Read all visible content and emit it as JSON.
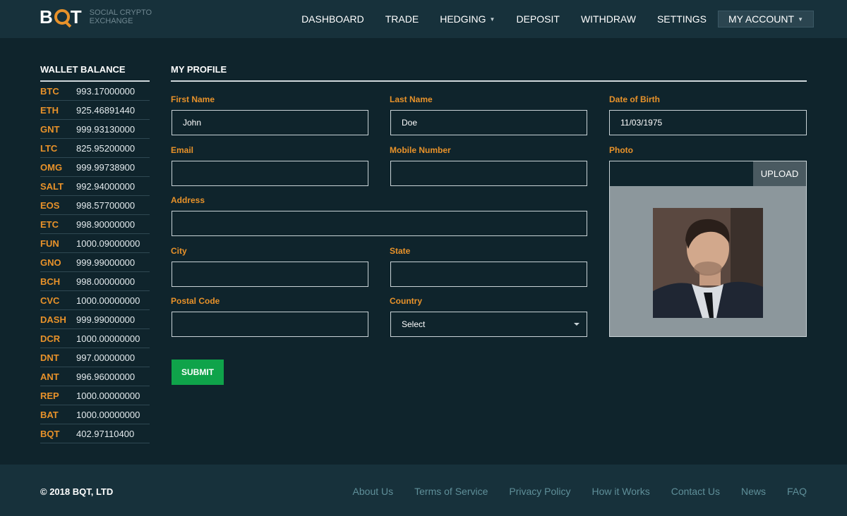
{
  "header": {
    "logo_text_left": "B",
    "logo_text_right": "T",
    "tagline_1": "SOCIAL CRYPTO",
    "tagline_2": "EXCHANGE",
    "nav": [
      {
        "label": "DASHBOARD"
      },
      {
        "label": "TRADE"
      },
      {
        "label": "HEDGING"
      },
      {
        "label": "DEPOSIT"
      },
      {
        "label": "WITHDRAW"
      },
      {
        "label": "SETTINGS"
      },
      {
        "label": "MY ACCOUNT"
      }
    ]
  },
  "sidebar": {
    "title": "WALLET BALANCE",
    "balances": [
      {
        "coin": "BTC",
        "amount": "993.17000000"
      },
      {
        "coin": "ETH",
        "amount": "925.46891440"
      },
      {
        "coin": "GNT",
        "amount": "999.93130000"
      },
      {
        "coin": "LTC",
        "amount": "825.95200000"
      },
      {
        "coin": "OMG",
        "amount": "999.99738900"
      },
      {
        "coin": "SALT",
        "amount": "992.94000000"
      },
      {
        "coin": "EOS",
        "amount": "998.57700000"
      },
      {
        "coin": "ETC",
        "amount": "998.90000000"
      },
      {
        "coin": "FUN",
        "amount": "1000.09000000"
      },
      {
        "coin": "GNO",
        "amount": "999.99000000"
      },
      {
        "coin": "BCH",
        "amount": "998.00000000"
      },
      {
        "coin": "CVC",
        "amount": "1000.00000000"
      },
      {
        "coin": "DASH",
        "amount": "999.99000000"
      },
      {
        "coin": "DCR",
        "amount": "1000.00000000"
      },
      {
        "coin": "DNT",
        "amount": "997.00000000"
      },
      {
        "coin": "ANT",
        "amount": "996.96000000"
      },
      {
        "coin": "REP",
        "amount": "1000.00000000"
      },
      {
        "coin": "BAT",
        "amount": "1000.00000000"
      },
      {
        "coin": "BQT",
        "amount": "402.97110400"
      }
    ]
  },
  "profile": {
    "title": "MY PROFILE",
    "first_name_label": "First Name",
    "first_name_value": "John",
    "last_name_label": "Last Name",
    "last_name_value": "Doe",
    "dob_label": "Date of Birth",
    "dob_value": "11/03/1975",
    "email_label": "Email",
    "email_value": "",
    "mobile_label": "Mobile Number",
    "mobile_value": "",
    "photo_label": "Photo",
    "upload_label": "UPLOAD",
    "address_label": "Address",
    "address_value": "",
    "city_label": "City",
    "city_value": "",
    "state_label": "State",
    "state_value": "",
    "postal_label": "Postal Code",
    "postal_value": "",
    "country_label": "Country",
    "country_selected": "Select",
    "submit_label": "SUBMIT"
  },
  "footer": {
    "copyright": "© 2018 BQT, LTD",
    "links": [
      {
        "label": "About Us"
      },
      {
        "label": "Terms of Service"
      },
      {
        "label": "Privacy Policy"
      },
      {
        "label": "How it Works"
      },
      {
        "label": "Contact Us"
      },
      {
        "label": "News"
      },
      {
        "label": "FAQ"
      }
    ]
  },
  "colors": {
    "background": "#0f242c",
    "header": "#17313b",
    "accent_orange": "#e8922a",
    "submit_green": "#0fa34a"
  }
}
